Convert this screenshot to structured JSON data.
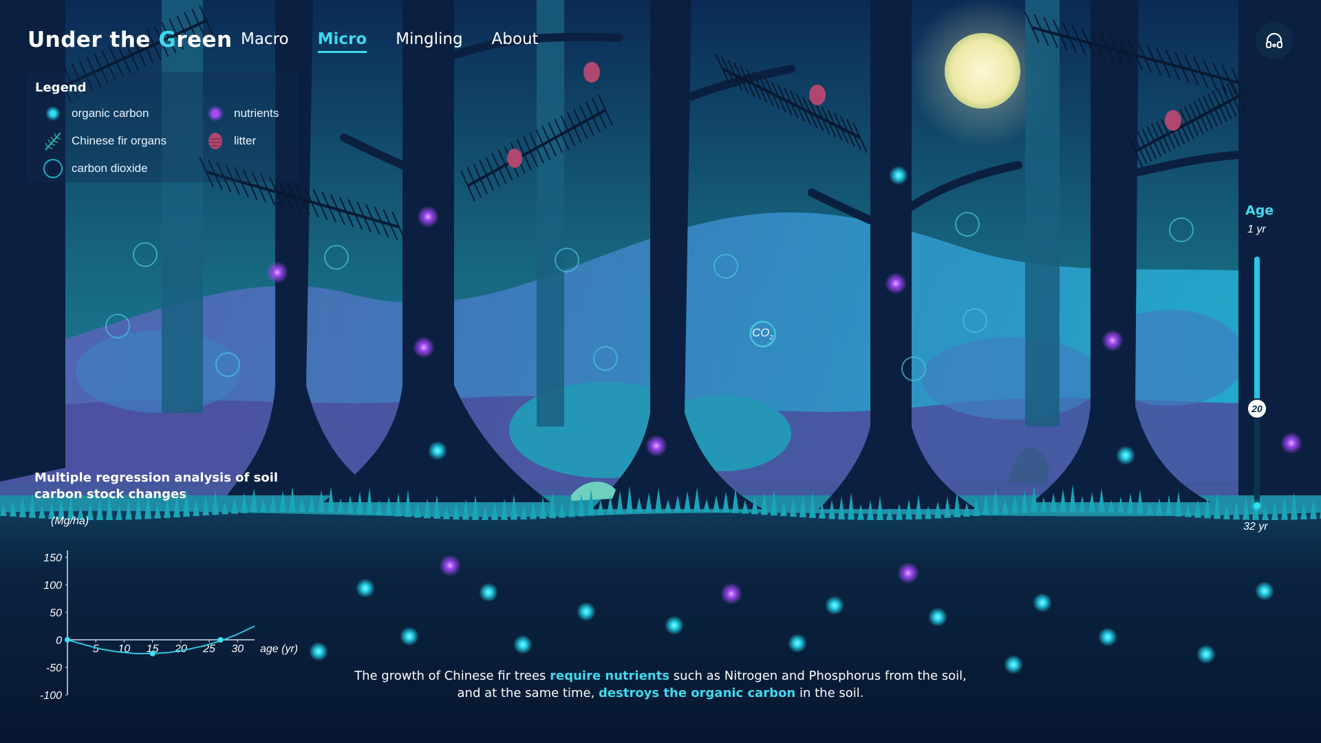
{
  "app": {
    "title_prefix": "Under the ",
    "title_accent": "G",
    "title_suffix": "reen"
  },
  "nav": {
    "items": [
      {
        "label": "Macro",
        "active": false
      },
      {
        "label": "Micro",
        "active": true
      },
      {
        "label": "Mingling",
        "active": false
      },
      {
        "label": "About",
        "active": false
      }
    ],
    "audio_icon": "headphones-icon"
  },
  "legend": {
    "title": "Legend",
    "items": [
      {
        "label": "organic carbon",
        "icon": "organic-carbon-dot-icon",
        "color": "#25e0f0"
      },
      {
        "label": "nutrients",
        "icon": "nutrient-dot-icon",
        "color": "#a34bf0"
      },
      {
        "label": "Chinese fir organs",
        "icon": "fir-branch-icon",
        "color": "#2fb7a8"
      },
      {
        "label": "litter",
        "icon": "litter-cone-icon",
        "color": "#b0476e"
      },
      {
        "label": "carbon dioxide",
        "icon": "co2-bubble-icon",
        "color": "#1ab0c8"
      }
    ]
  },
  "scene": {
    "co2_label": "CO",
    "co2_sub": "2"
  },
  "age": {
    "title": "Age",
    "min_label": "1 yr",
    "max_label": "32 yr",
    "value": 20,
    "min": 1,
    "max": 32
  },
  "chart": {
    "title": "Multiple regression analysis of soil carbon stock changes"
  },
  "chart_data": {
    "type": "line",
    "title": "Multiple regression analysis of soil carbon stock changes",
    "ylabel": "(Mg/ha)",
    "xlabel": "age (yr)",
    "xticks": [
      5,
      10,
      15,
      20,
      25,
      30
    ],
    "yticks": [
      150,
      100,
      50,
      0,
      -50,
      -100
    ],
    "xlim": [
      0,
      33
    ],
    "ylim": [
      -100,
      150
    ],
    "series": [
      {
        "x": [
          0,
          3,
          6,
          9,
          12,
          15,
          18,
          21,
          24,
          27,
          30,
          33
        ],
        "values": [
          0,
          -9,
          -17,
          -22,
          -25,
          -25,
          -23,
          -18,
          -11,
          -2,
          10,
          25
        ]
      }
    ],
    "markers": [
      {
        "x": 0,
        "y": 0
      },
      {
        "x": 15,
        "y": -25
      },
      {
        "x": 27,
        "y": 0
      }
    ],
    "grid": false,
    "color": "#2fc6e0"
  },
  "caption": {
    "p1": "The growth of Chinese fir trees ",
    "h1": "require nutrients",
    "p2": " such as Nitrogen and Phosphorus from the soil,",
    "p3": "and at the same time, ",
    "h2": "destroys the organic carbon",
    "p4": " in the soil."
  }
}
